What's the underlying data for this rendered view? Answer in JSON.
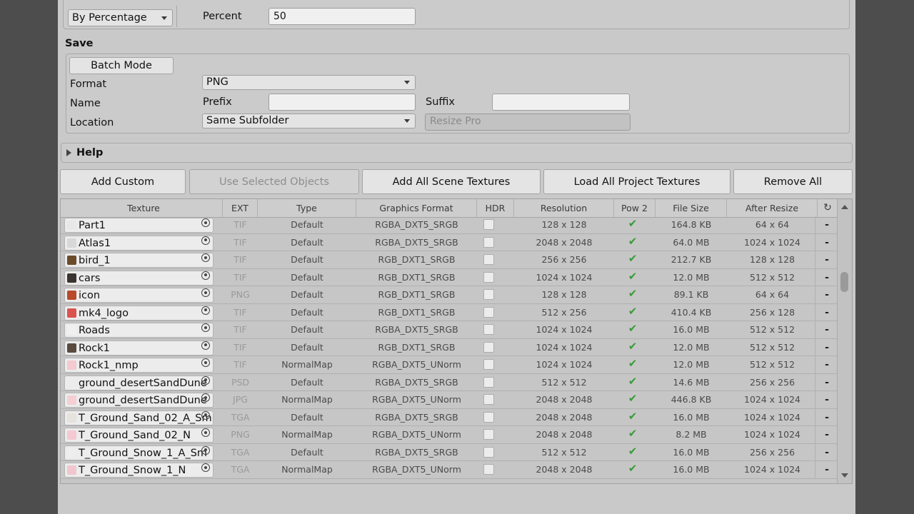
{
  "resize": {
    "mode_value": "By Percentage",
    "percent_label": "Percent",
    "percent_value": "50"
  },
  "save": {
    "section_title": "Save",
    "batch_mode_label": "Batch Mode",
    "format_label": "Format",
    "format_value": "PNG",
    "name_label": "Name",
    "prefix_label": "Prefix",
    "prefix_value": "",
    "suffix_label": "Suffix",
    "suffix_value": "",
    "location_label": "Location",
    "location_value": "Same Subfolder",
    "folder_value": "Resize Pro"
  },
  "help": {
    "title": "Help"
  },
  "toolbar": {
    "add_custom": "Add Custom",
    "use_selected": "Use Selected Objects",
    "add_scene": "Add All Scene Textures",
    "load_project": "Load All Project Textures",
    "remove_all": "Remove All"
  },
  "table": {
    "headers": {
      "texture": "Texture",
      "ext": "EXT",
      "type": "Type",
      "format": "Graphics Format",
      "hdr": "HDR",
      "resolution": "Resolution",
      "pow2": "Pow 2",
      "filesize": "File Size",
      "after": "After Resize",
      "refresh_icon": "refresh-icon"
    },
    "rows": [
      {
        "name": "Part1",
        "ext": "TIF",
        "type": "Default",
        "format": "RGBA_DXT5_SRGB",
        "resolution": "128 x 128",
        "size": "164.8 KB",
        "after": "64 x 64",
        "thumb": "#e8e8e8",
        "action": "-"
      },
      {
        "name": "Atlas1",
        "ext": "TIF",
        "type": "Default",
        "format": "RGBA_DXT5_SRGB",
        "resolution": "2048 x 2048",
        "size": "64.0 MB",
        "after": "1024 x 1024",
        "thumb": "#d8d8d8",
        "action": "-"
      },
      {
        "name": "bird_1",
        "ext": "TIF",
        "type": "Default",
        "format": "RGB_DXT1_SRGB",
        "resolution": "256 x 256",
        "size": "212.7 KB",
        "after": "128 x 128",
        "thumb": "#6b4b2a",
        "action": "-"
      },
      {
        "name": "cars",
        "ext": "TIF",
        "type": "Default",
        "format": "RGB_DXT1_SRGB",
        "resolution": "1024 x 1024",
        "size": "12.0 MB",
        "after": "512 x 512",
        "thumb": "#3a3530",
        "action": "-"
      },
      {
        "name": "icon",
        "ext": "PNG",
        "type": "Default",
        "format": "RGB_DXT1_SRGB",
        "resolution": "128 x 128",
        "size": "89.1 KB",
        "after": "64 x 64",
        "thumb": "#b84a2a",
        "action": "-"
      },
      {
        "name": "mk4_logo",
        "ext": "TIF",
        "type": "Default",
        "format": "RGB_DXT1_SRGB",
        "resolution": "512 x 256",
        "size": "410.4 KB",
        "after": "256 x 128",
        "thumb": "#d9534f",
        "action": "-"
      },
      {
        "name": "Roads",
        "ext": "TIF",
        "type": "Default",
        "format": "RGBA_DXT5_SRGB",
        "resolution": "1024 x 1024",
        "size": "16.0 MB",
        "after": "512 x 512",
        "thumb": "#f0f0f0",
        "action": "-"
      },
      {
        "name": "Rock1",
        "ext": "TIF",
        "type": "Default",
        "format": "RGB_DXT1_SRGB",
        "resolution": "1024 x 1024",
        "size": "12.0 MB",
        "after": "512 x 512",
        "thumb": "#5a4a40",
        "action": "-"
      },
      {
        "name": "Rock1_nmp",
        "ext": "TIF",
        "type": "NormalMap",
        "format": "RGBA_DXT5_UNorm",
        "resolution": "1024 x 1024",
        "size": "12.0 MB",
        "after": "512 x 512",
        "thumb": "#f4c9cf",
        "action": "-"
      },
      {
        "name": "ground_desertSandDune",
        "ext": "PSD",
        "type": "Default",
        "format": "RGBA_DXT5_SRGB",
        "resolution": "512 x 512",
        "size": "14.6 MB",
        "after": "256 x 256",
        "thumb": "#ececec",
        "action": "-"
      },
      {
        "name": "ground_desertSandDune",
        "ext": "JPG",
        "type": "NormalMap",
        "format": "RGBA_DXT5_UNorm",
        "resolution": "2048 x 2048",
        "size": "446.8 KB",
        "after": "1024 x 1024",
        "thumb": "#f4cfd4",
        "action": "-"
      },
      {
        "name": "T_Ground_Sand_02_A_Sm",
        "ext": "TGA",
        "type": "Default",
        "format": "RGBA_DXT5_SRGB",
        "resolution": "2048 x 2048",
        "size": "16.0 MB",
        "after": "1024 x 1024",
        "thumb": "#e6e2dc",
        "action": "-"
      },
      {
        "name": "T_Ground_Sand_02_N",
        "ext": "PNG",
        "type": "NormalMap",
        "format": "RGBA_DXT5_UNorm",
        "resolution": "2048 x 2048",
        "size": "8.2 MB",
        "after": "1024 x 1024",
        "thumb": "#f4c9d2",
        "action": "-"
      },
      {
        "name": "T_Ground_Snow_1_A_Sm",
        "ext": "TGA",
        "type": "Default",
        "format": "RGBA_DXT5_SRGB",
        "resolution": "512 x 512",
        "size": "16.0 MB",
        "after": "256 x 256",
        "thumb": "#eeeeee",
        "action": "-"
      },
      {
        "name": "T_Ground_Snow_1_N",
        "ext": "TGA",
        "type": "NormalMap",
        "format": "RGBA_DXT5_UNorm",
        "resolution": "2048 x 2048",
        "size": "16.0 MB",
        "after": "1024 x 1024",
        "thumb": "#f2c6cf",
        "action": "-"
      }
    ]
  },
  "colors": {
    "check": "#3a9a3a"
  }
}
